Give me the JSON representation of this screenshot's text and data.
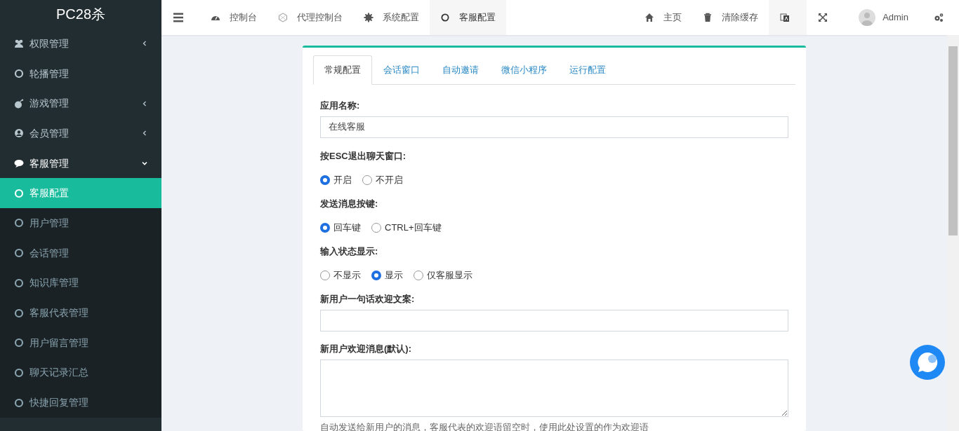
{
  "brand": "PC28杀",
  "sidebar": {
    "items": [
      {
        "label": "权限管理",
        "kind": "group",
        "expanded": false
      },
      {
        "label": "轮播管理",
        "kind": "leaf",
        "selected": false
      },
      {
        "label": "游戏管理",
        "kind": "group",
        "expanded": false
      },
      {
        "label": "会员管理",
        "kind": "group",
        "expanded": false
      },
      {
        "label": "客服管理",
        "kind": "group",
        "expanded": true,
        "children": [
          {
            "label": "客服配置",
            "selected": true
          },
          {
            "label": "用户管理",
            "selected": false
          },
          {
            "label": "会话管理",
            "selected": false
          },
          {
            "label": "知识库管理",
            "selected": false
          },
          {
            "label": "客服代表管理",
            "selected": false
          },
          {
            "label": "用户留言管理",
            "selected": false
          },
          {
            "label": "聊天记录汇总",
            "selected": false
          },
          {
            "label": "快捷回复管理",
            "selected": false
          }
        ]
      }
    ]
  },
  "topbar": {
    "tabs": [
      {
        "label": "控制台",
        "selected": false
      },
      {
        "label": "代理控制台",
        "selected": false
      },
      {
        "label": "系统配置",
        "selected": false
      },
      {
        "label": "客服配置",
        "selected": true
      }
    ],
    "links": [
      {
        "label": "主页"
      },
      {
        "label": "清除缓存"
      }
    ],
    "user": "Admin"
  },
  "config_tabs": [
    {
      "label": "常规配置",
      "selected": true
    },
    {
      "label": "会话窗口",
      "selected": false
    },
    {
      "label": "自动邀请",
      "selected": false
    },
    {
      "label": "微信小程序",
      "selected": false
    },
    {
      "label": "运行配置",
      "selected": false
    }
  ],
  "fields": [
    {
      "kind": "text",
      "label": "应用名称:",
      "value": "在线客服"
    },
    {
      "kind": "radio",
      "label": "按ESC退出聊天窗口:",
      "options": [
        {
          "label": "开启",
          "selected": true
        },
        {
          "label": "不开启",
          "selected": false
        }
      ]
    },
    {
      "kind": "radio",
      "label": "发送消息按键:",
      "options": [
        {
          "label": "回车键",
          "selected": true
        },
        {
          "label": "CTRL+回车键",
          "selected": false
        }
      ]
    },
    {
      "kind": "radio",
      "label": "输入状态显示:",
      "options": [
        {
          "label": "不显示",
          "selected": false
        },
        {
          "label": "显示",
          "selected": true
        },
        {
          "label": "仅客服显示",
          "selected": false
        }
      ]
    },
    {
      "kind": "text",
      "label": "新用户一句话欢迎文案:"
    },
    {
      "kind": "textarea",
      "label": "新用户欢迎消息(默认):",
      "help": "自动发送给新用户的消息，客服代表的欢迎语留空时，使用此处设置的作为欢迎语"
    }
  ]
}
